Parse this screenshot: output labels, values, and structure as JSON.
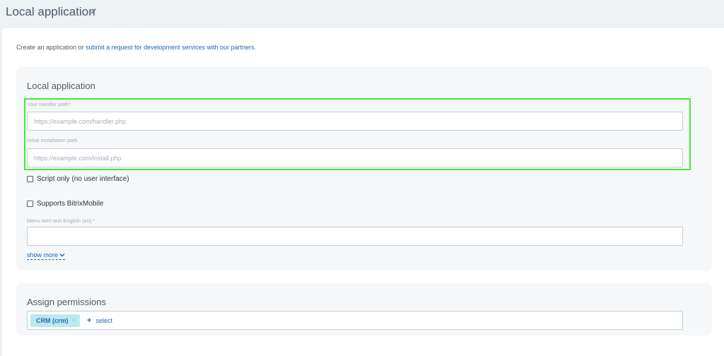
{
  "header": {
    "title": "Local application"
  },
  "intro": {
    "prefix": "Create an application or ",
    "link": "submit a request for development services with our partners."
  },
  "local_app": {
    "title": "Local application",
    "handler_label": "Your handler path*",
    "handler_placeholder": "https://example.com/handler.php",
    "install_label": "Initial installation path",
    "install_placeholder": "https://example.com/install.php",
    "script_only_label": "Script only (no user interface)",
    "mobile_label": "Supports BitrixMobile",
    "menu_label": "Menu item text English (en) *",
    "menu_value": "",
    "show_more": "show more"
  },
  "permissions": {
    "title": "Assign permissions",
    "tags": [
      "CRM (crm)"
    ],
    "tag_remove": "×",
    "add_plus": "+",
    "add_label": "select"
  },
  "colors": {
    "link": "#2067b0",
    "highlight": "#3cf02a",
    "tag_bg": "#bce8f1"
  }
}
